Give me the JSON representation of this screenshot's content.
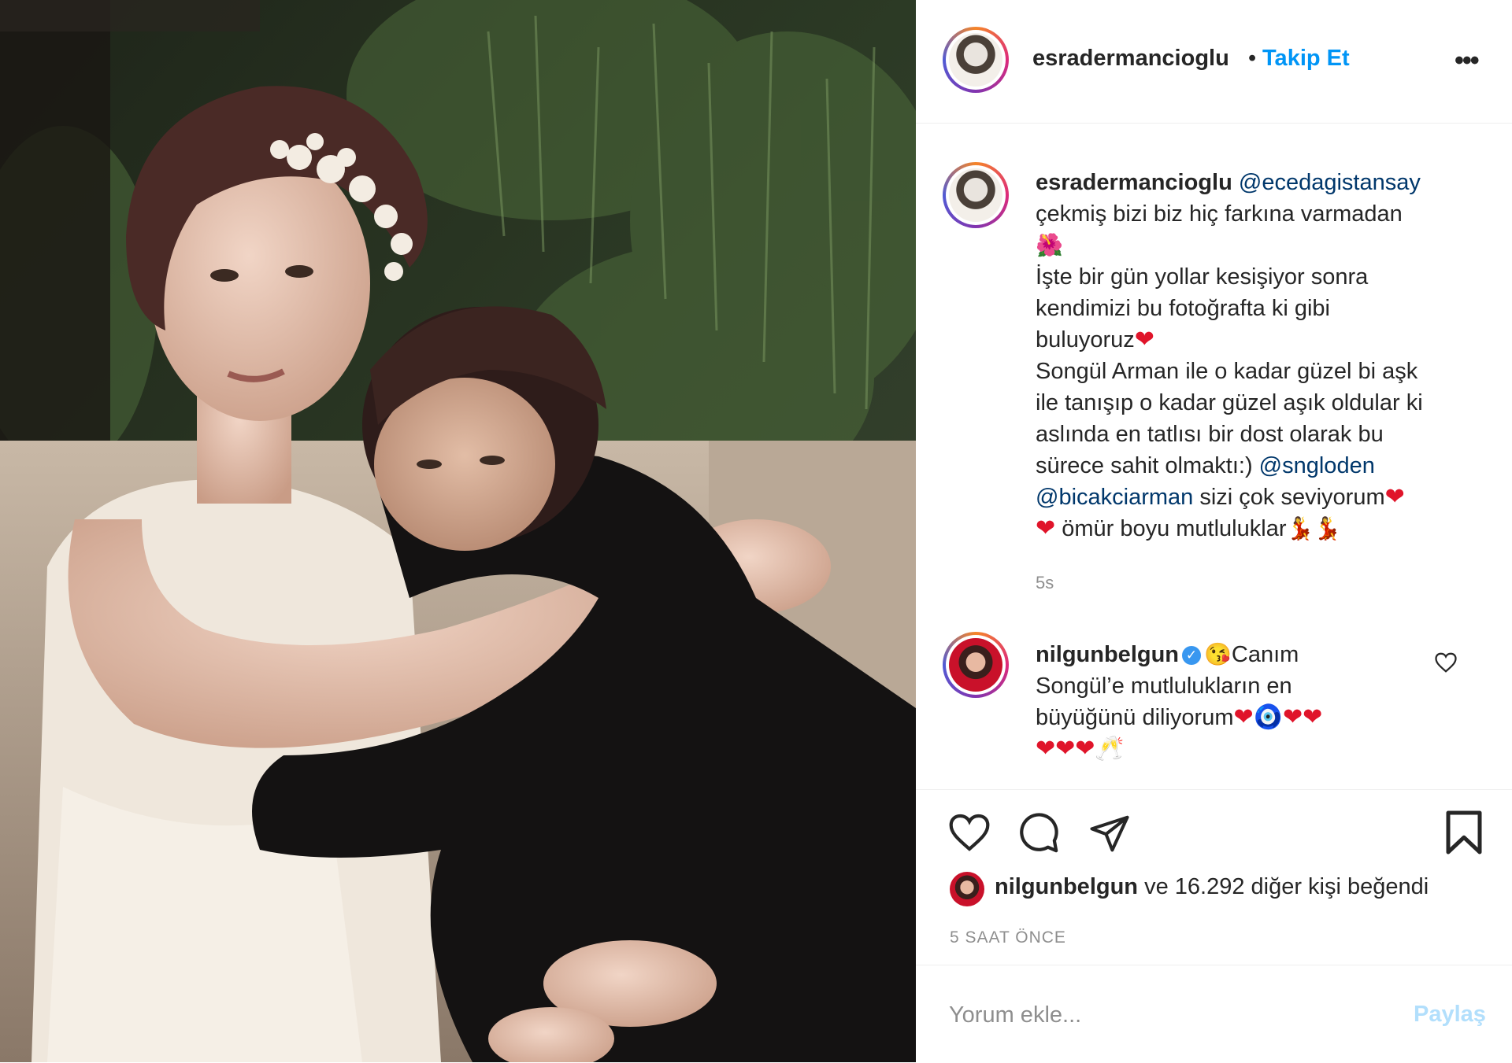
{
  "post": {
    "username": "esradermancioglu",
    "separator": "•",
    "follow_label": "Takip Et",
    "more_label": "•••"
  },
  "caption": {
    "username": "esradermancioglu",
    "mention1": "@ecedagistansay",
    "line1": "çekmiş bizi biz hiç farkına varmadan",
    "line2_emoji": "🌺",
    "line3": "İşte bir gün yollar kesişiyor sonra",
    "line4": "kendimizi bu fotoğrafta ki gibi",
    "line5": "buluyoruz",
    "line6": "Songül Arman ile o kadar güzel bi aşk",
    "line7": "ile tanışıp o kadar güzel aşık oldular ki",
    "line8": "aslında en tatlısı bir dost olarak bu",
    "line9": "sürece sahit olmaktı:)",
    "mention2": "@sngloden",
    "mention3": "@bicakciarman",
    "line10": " sizi çok seviyorum",
    "line11": " ömür boyu mutluluklar",
    "heart": "❤",
    "couple_emoji": "💃💃",
    "time": "5s"
  },
  "comment": {
    "username": "nilgunbelgun",
    "verified_mark": "✓",
    "lead_emoji": "😘",
    "text1": "Canım",
    "text2": "Songül’e mutlulukların en",
    "text3": "büyüğünü diliyorum",
    "emojis_line3": "❤🧿❤❤",
    "emojis_line4": "❤❤❤🥂"
  },
  "likes": {
    "user": "nilgunbelgun",
    "rest": " ve 16.292 diğer kişi beğendi"
  },
  "timestamp": "5 SAAT ÖNCE",
  "comment_box": {
    "placeholder": "Yorum ekle...",
    "post_label": "Paylaş"
  },
  "colors": {
    "accent": "#0095f6",
    "mention": "#00376b",
    "muted": "#8e8e8e",
    "post_disabled": "#b2dffc"
  }
}
